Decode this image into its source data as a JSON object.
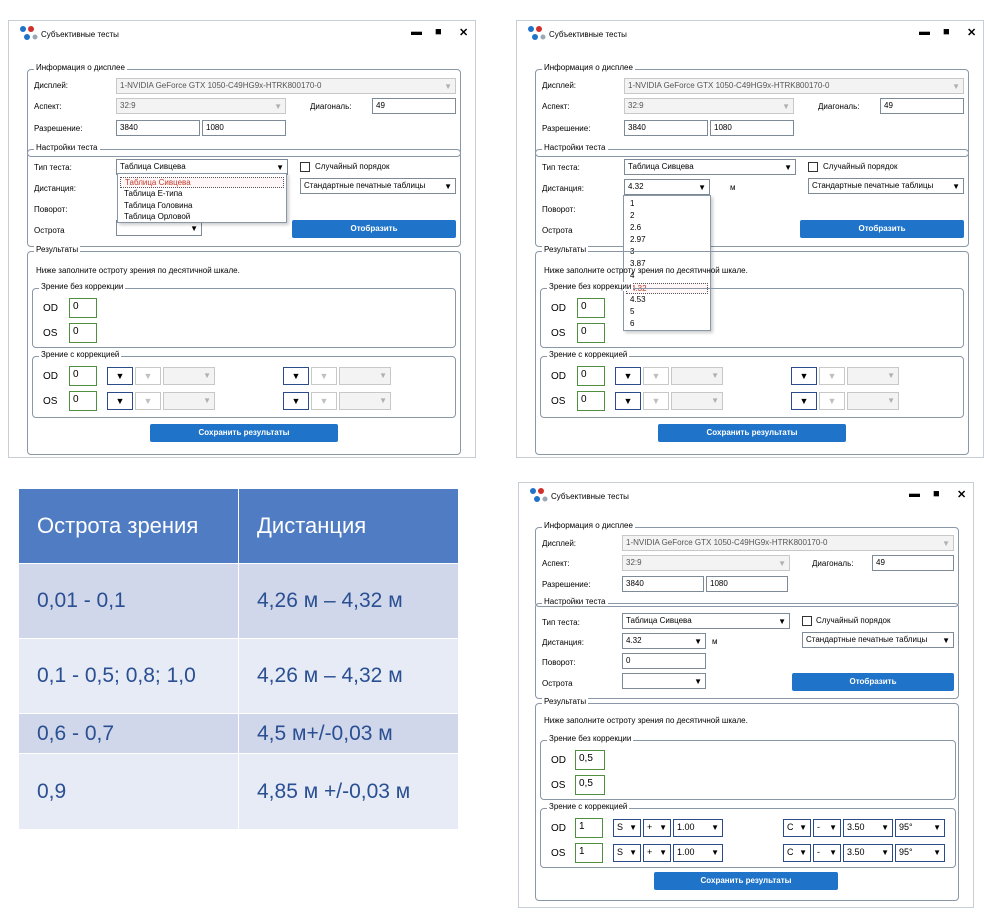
{
  "window": {
    "title": "Субъективные тесты",
    "min_icon": "▬",
    "max_icon": "■",
    "close_icon": "✕"
  },
  "display": {
    "section": "Информация о дисплее",
    "display_label": "Дисплей:",
    "display_value": "1-NVIDIA GeForce GTX 1050-C49HG9x-HTRK800170-0",
    "aspect_label": "Аспект:",
    "aspect_value": "32:9",
    "diag_label": "Диагональ:",
    "diag_value": "49",
    "res_label": "Разрешение:",
    "res_w": "3840",
    "res_h": "1080"
  },
  "settings": {
    "section": "Настройки теста",
    "type_label": "Тип теста:",
    "type_value": "Таблица Сивцева",
    "random_label": "Случайный порядок",
    "dist_label": "Дистанция:",
    "dist_value": "4.32",
    "dist_unit": "м",
    "charts_value": "Стандартные печатные таблицы",
    "rot_label": "Поворот:",
    "rot_value": "0",
    "acuity_label": "Острота",
    "show_btn": "Отобразить"
  },
  "results": {
    "section": "Результаты",
    "hint": "Ниже заполните остроту зрения по десятичной шкале.",
    "nocorr_section": "Зрение без коррекции",
    "corr_section": "Зрение с коррекцией",
    "od": "OD",
    "os": "OS",
    "save_btn": "Сохранить результаты"
  },
  "win1": {
    "od_val": "0",
    "os_val": "0",
    "corr_od": "0",
    "corr_os": "0",
    "dropdown": [
      "Таблица Сивцева",
      "Таблица Е-типа",
      "Таблица Головина",
      "Таблица Орловой"
    ]
  },
  "win2": {
    "od_val": "0",
    "os_val": "0",
    "corr_od": "0",
    "corr_os": "0",
    "dropdown": [
      "1",
      "2",
      "2.6",
      "2.97",
      "3",
      "3.87",
      "4",
      "4.32",
      "4.53",
      "5",
      "6"
    ]
  },
  "win3": {
    "od_val": "0,5",
    "os_val": "0,5",
    "corr_od": "1",
    "corr_os": "1",
    "sign_s": "S",
    "sign_plus": "+",
    "sph": "1.00",
    "sign_c": "C",
    "sign_minus": "-",
    "cyl": "3.50",
    "axis": "95°"
  },
  "table": {
    "headers": [
      "Острота зрения",
      "Дистанция"
    ],
    "rows": [
      [
        "0,01 - 0,1",
        "4,26 м – 4,32 м"
      ],
      [
        "0,1 - 0,5; 0,8; 1,0",
        "4,26 м – 4,32 м"
      ],
      [
        "0,6 - 0,7",
        "4,5 м+/-0,03 м"
      ],
      [
        "0,9",
        "4,85 м +/-0,03 м"
      ]
    ]
  },
  "colors": {
    "button_blue": "#1f74c9",
    "table_header": "#4f7cc2",
    "selected_red": "#c0392b"
  }
}
